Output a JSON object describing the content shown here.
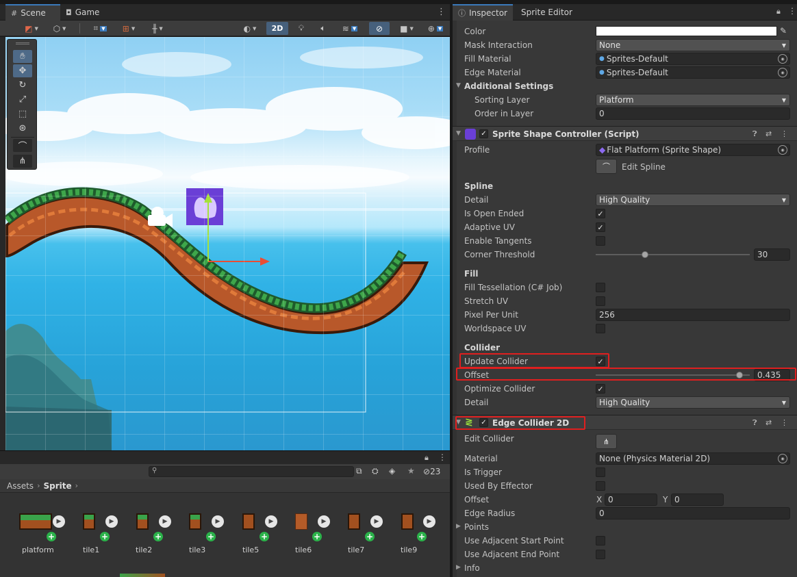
{
  "scene_tabs": {
    "scene": "Scene",
    "game": "Game"
  },
  "toolbar": {
    "mode_2d": "2D"
  },
  "project": {
    "search_placeholder": "",
    "hidden_count": "23",
    "breadcrumb": {
      "root": "Assets",
      "folder": "Sprite"
    },
    "assets": [
      {
        "name": "platform"
      },
      {
        "name": "tile1"
      },
      {
        "name": "tile2"
      },
      {
        "name": "tile3"
      },
      {
        "name": "tile5"
      },
      {
        "name": "tile6"
      },
      {
        "name": "tile7"
      },
      {
        "name": "tile9"
      }
    ]
  },
  "inspector": {
    "tabs": {
      "inspector": "Inspector",
      "sprite_editor": "Sprite Editor"
    },
    "renderer": {
      "color_label": "Color",
      "mask_label": "Mask Interaction",
      "mask_value": "None",
      "fill_material_label": "Fill Material",
      "fill_material_value": "Sprites-Default",
      "edge_material_label": "Edge Material",
      "edge_material_value": "Sprites-Default",
      "additional_settings": "Additional Settings",
      "sorting_layer_label": "Sorting Layer",
      "sorting_layer_value": "Platform",
      "order_label": "Order in Layer",
      "order_value": "0"
    },
    "controller": {
      "title": "Sprite Shape Controller (Script)",
      "profile_label": "Profile",
      "profile_value": "Flat Platform (Sprite Shape)",
      "edit_spline": "Edit Spline",
      "spline_header": "Spline",
      "detail_label": "Detail",
      "detail_value": "High Quality",
      "open_ended_label": "Is Open Ended",
      "open_ended": true,
      "adaptive_uv_label": "Adaptive UV",
      "adaptive_uv": true,
      "tangents_label": "Enable Tangents",
      "tangents": false,
      "corner_label": "Corner Threshold",
      "corner_value": "30",
      "corner_fraction": 0.32,
      "fill_header": "Fill",
      "tess_label": "Fill Tessellation (C# Job)",
      "tess": false,
      "stretch_label": "Stretch UV",
      "stretch": false,
      "ppu_label": "Pixel Per Unit",
      "ppu_value": "256",
      "worldspace_label": "Worldspace UV",
      "worldspace": false,
      "collider_header": "Collider",
      "update_collider_label": "Update Collider",
      "update_collider": true,
      "offset_label": "Offset",
      "offset_value": "0.435",
      "offset_fraction": 0.935,
      "optimize_label": "Optimize Collider",
      "optimize": true,
      "col_detail_label": "Detail",
      "col_detail_value": "High Quality"
    },
    "edge_collider": {
      "title": "Edge Collider 2D",
      "edit_label": "Edit Collider",
      "material_label": "Material",
      "material_value": "None (Physics Material 2D)",
      "trigger_label": "Is Trigger",
      "trigger": false,
      "effector_label": "Used By Effector",
      "effector": false,
      "offset_label": "Offset",
      "offset_x_label": "X",
      "offset_x": "0",
      "offset_y_label": "Y",
      "offset_y": "0",
      "radius_label": "Edge Radius",
      "radius_value": "0",
      "points_label": "Points",
      "adj_start_label": "Use Adjacent Start Point",
      "adj_start": false,
      "adj_end_label": "Use Adjacent End Point",
      "adj_end": false,
      "info_label": "Info"
    }
  },
  "colors": {
    "accent": "#3a79bb",
    "highlight": "#e01f1f",
    "panel": "#383838"
  }
}
